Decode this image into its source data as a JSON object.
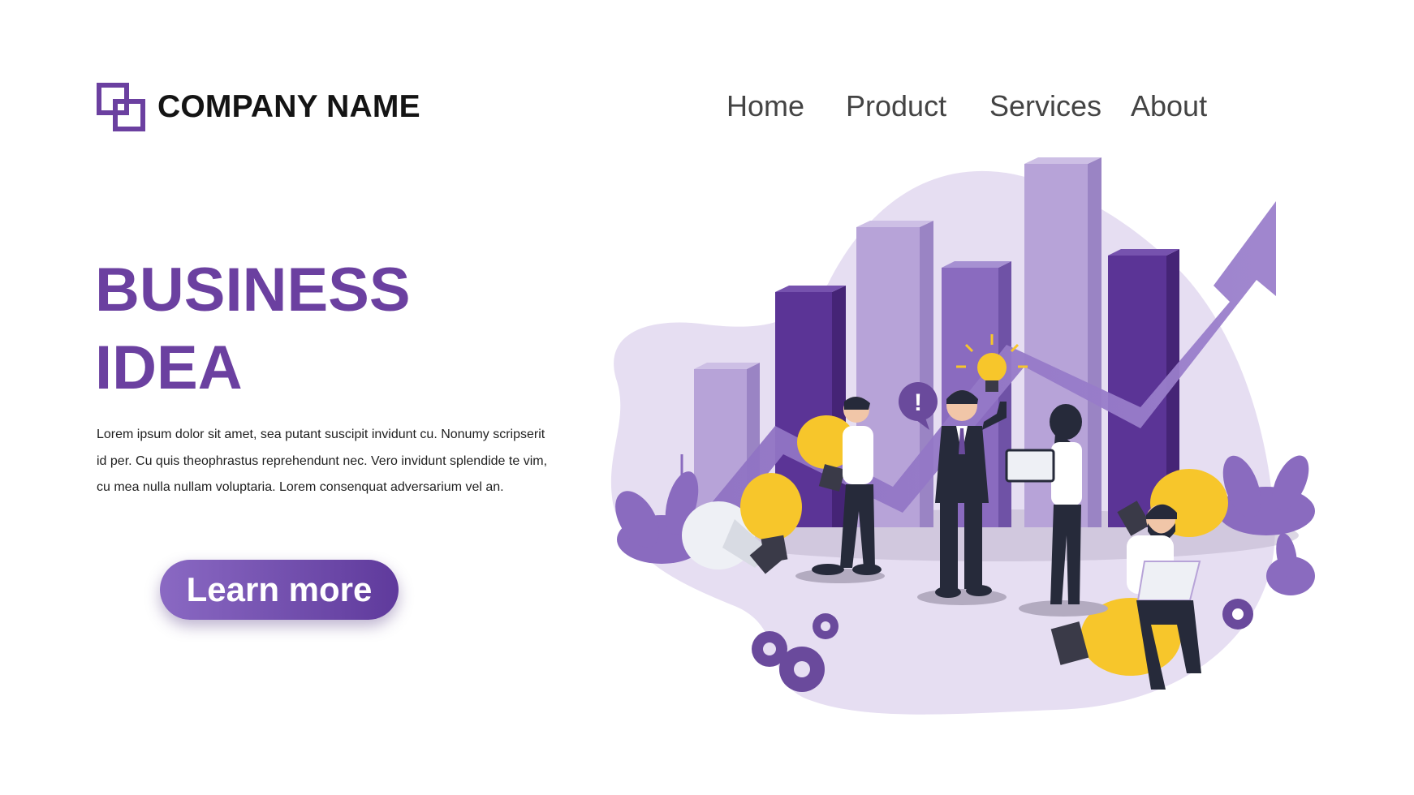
{
  "brand": {
    "name": "COMPANY NAME",
    "logo_icon": "overlapping-squares-icon",
    "color": "#6b40a0"
  },
  "nav": {
    "items": [
      "Home",
      "Product",
      "Services",
      "About"
    ]
  },
  "hero": {
    "title_line1": "BUSINESS",
    "title_line2": "IDEA",
    "body": "Lorem ipsum dolor sit amet, sea putant suscipit invidunt cu. Nonumy scripserit id per. Cu quis theophrastus reprehendunt nec. Vero invidunt splendide te vim, cu mea nulla nullam voluptaria. Lorem consenquat adversarium vel an.",
    "cta_label": "Learn more"
  },
  "illustration": {
    "exclamation": "!",
    "colors": {
      "purple_dark": "#5b3496",
      "purple_mid": "#8a6bbf",
      "purple_light": "#b7a3d8",
      "blob": "#e6def2",
      "bulb_yellow": "#f7c62b"
    }
  }
}
